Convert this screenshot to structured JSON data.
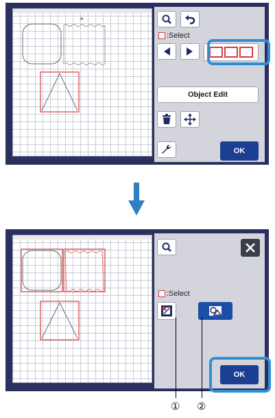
{
  "top": {
    "select_label": ":Select",
    "object_edit_label": "Object Edit",
    "ok_label": "OK"
  },
  "bottom": {
    "select_label": ":Select",
    "ok_label": "OK"
  },
  "callouts": [
    "①",
    "②"
  ],
  "colors": {
    "screen_bg": "#2a2f5e",
    "panel_bg": "#d4d5dc",
    "ok_blue": "#1c3f91",
    "highlight": "#2f8fd6",
    "select_red": "#d43c3c"
  }
}
